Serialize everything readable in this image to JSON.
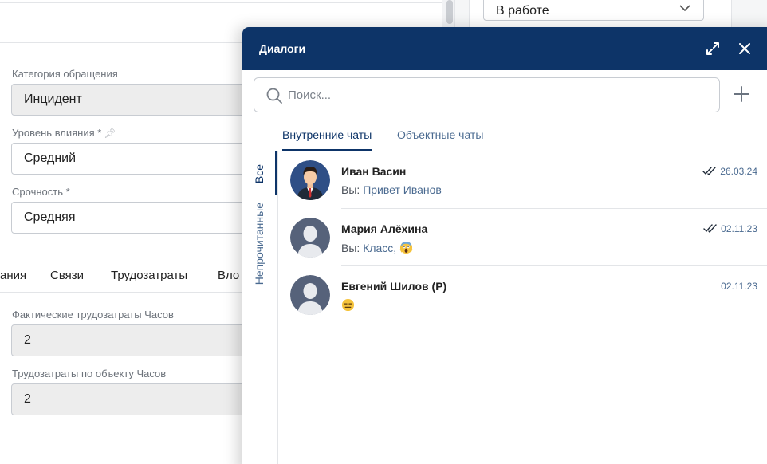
{
  "form": {
    "status_value": "В работе",
    "category_label": "Категория обращения",
    "category_value": "Инцидент",
    "impact_label": "Уровень влияния *",
    "impact_value": "Средний",
    "urgency_label": "Срочность *",
    "urgency_value": "Средняя",
    "tabs": [
      "ания",
      "Связи",
      "Трудозатраты",
      "Вло"
    ],
    "actual_labor_label": "Фактические трудозатраты Часов",
    "actual_labor_value": "2",
    "object_labor_label": "Трудозатраты по объекту Часов",
    "object_labor_value": "2"
  },
  "dialog": {
    "title": "Диалоги",
    "search_placeholder": "Поиск...",
    "tabs": [
      "Внутренние чаты",
      "Объектные чаты"
    ],
    "filters": [
      "Все",
      "Непрочитанные"
    ],
    "chats": [
      {
        "name": "Иван Васин",
        "prefix": "Вы: ",
        "text": "Привет Иванов",
        "date": "26.03.24",
        "read": true,
        "avatar": "man-avatar-icon",
        "emoji": ""
      },
      {
        "name": "Мария Алёхина",
        "prefix": "Вы: ",
        "text": "Класс, ",
        "date": "02.11.23",
        "read": true,
        "avatar": "default-avatar-icon",
        "emoji": "scream-emoji"
      },
      {
        "name": "Евгений Шилов (Р)",
        "prefix": "",
        "text": "",
        "date": "02.11.23",
        "read": false,
        "avatar": "default-avatar-icon",
        "emoji": "expressionless-emoji"
      }
    ]
  },
  "colors": {
    "header": "#0d3468",
    "accent": "#0d3468",
    "link": "#4a6a90"
  }
}
